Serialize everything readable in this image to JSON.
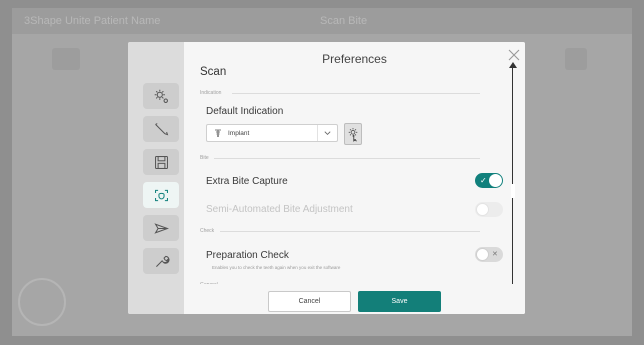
{
  "background": {
    "app_title": "3Shape Unite  Patient Name",
    "center_title": "Scan  Bite"
  },
  "dialog": {
    "title": "Preferences",
    "section_title": "Scan",
    "groups": {
      "indication": "Indication",
      "bite": "Bite",
      "check": "Check",
      "general": "General"
    },
    "default_indication": {
      "label": "Default Indication",
      "selected": "Implant"
    },
    "settings": {
      "extra_bite_capture": {
        "label": "Extra Bite Capture",
        "enabled": true
      },
      "semi_automated_bite_adjustment": {
        "label": "Semi-Automated Bite Adjustment",
        "enabled": false,
        "disabled": true
      },
      "preparation_check": {
        "label": "Preparation Check",
        "description": "Enables you to check the teeth again when you exit the software",
        "enabled": false
      }
    },
    "footer": {
      "cancel_label": "Cancel",
      "save_label": "Save"
    },
    "sidebar": [
      {
        "name": "general-settings",
        "icon": "gear-settings-icon"
      },
      {
        "name": "design",
        "icon": "pen-icon"
      },
      {
        "name": "save",
        "icon": "floppy-disk-icon"
      },
      {
        "name": "scan",
        "icon": "scan-icon",
        "active": true
      },
      {
        "name": "send",
        "icon": "send-icon"
      },
      {
        "name": "tools",
        "icon": "wrench-icon"
      }
    ]
  },
  "colors": {
    "accent": "#11807c",
    "overlay": "#8f8f8f"
  }
}
